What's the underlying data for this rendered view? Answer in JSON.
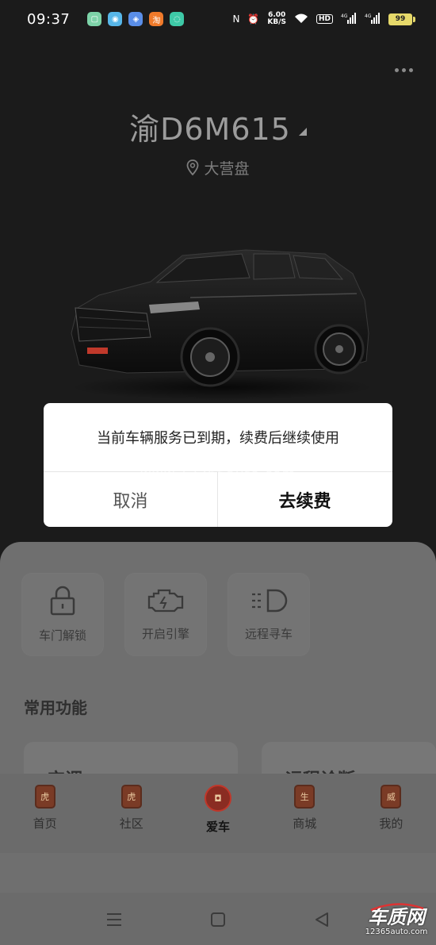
{
  "status_bar": {
    "time": "09:37",
    "notifications": [
      {
        "name": "messages-app-icon",
        "color": "#7dd3a8",
        "glyph": "▢"
      },
      {
        "name": "browser-app-icon",
        "color": "#57b6e8",
        "glyph": "◉"
      },
      {
        "name": "chat-app-icon",
        "color": "#5a8ee8",
        "glyph": "◈"
      },
      {
        "name": "taobao-app-icon",
        "color": "#f07a2a",
        "glyph": "淘"
      },
      {
        "name": "message-bubble-app-icon",
        "color": "#3ec9a7",
        "glyph": "◌"
      }
    ],
    "speed_value": "6.00",
    "speed_unit": "KB/S",
    "hd_label": "HD",
    "signal_1": "4G",
    "signal_2": "4G",
    "battery": "99"
  },
  "vehicle": {
    "plate": "渝D6M615",
    "location": "大营盘"
  },
  "modal": {
    "message": "当前车辆服务已到期，续费后继续使用",
    "cancel_label": "取消",
    "renew_label": "去续费"
  },
  "quick_actions": [
    {
      "label": "车门解锁",
      "icon": "lock-icon"
    },
    {
      "label": "开启引擎",
      "icon": "engine-icon"
    },
    {
      "label": "远程寻车",
      "icon": "headlight-icon"
    }
  ],
  "section_title": "常用功能",
  "function_cards": [
    {
      "label": "空调"
    },
    {
      "label": "远程诊断"
    }
  ],
  "tabs": [
    {
      "label": "首页",
      "icon_glyph": "虎",
      "active": false
    },
    {
      "label": "社区",
      "icon_glyph": "虎",
      "active": false
    },
    {
      "label": "爱车",
      "icon_glyph": "◘",
      "active": true
    },
    {
      "label": "商城",
      "icon_glyph": "生",
      "active": false
    },
    {
      "label": "我的",
      "icon_glyph": "威",
      "active": false
    }
  ],
  "watermark": {
    "center_text": "www.12365auto.com",
    "brand_name": "车质网",
    "brand_url": "12365auto.com"
  },
  "colors": {
    "background": "#1b1b1b",
    "sheet": "#6f6f6f",
    "modal": "#ffffff",
    "tab_icon": "#7a3b26"
  }
}
